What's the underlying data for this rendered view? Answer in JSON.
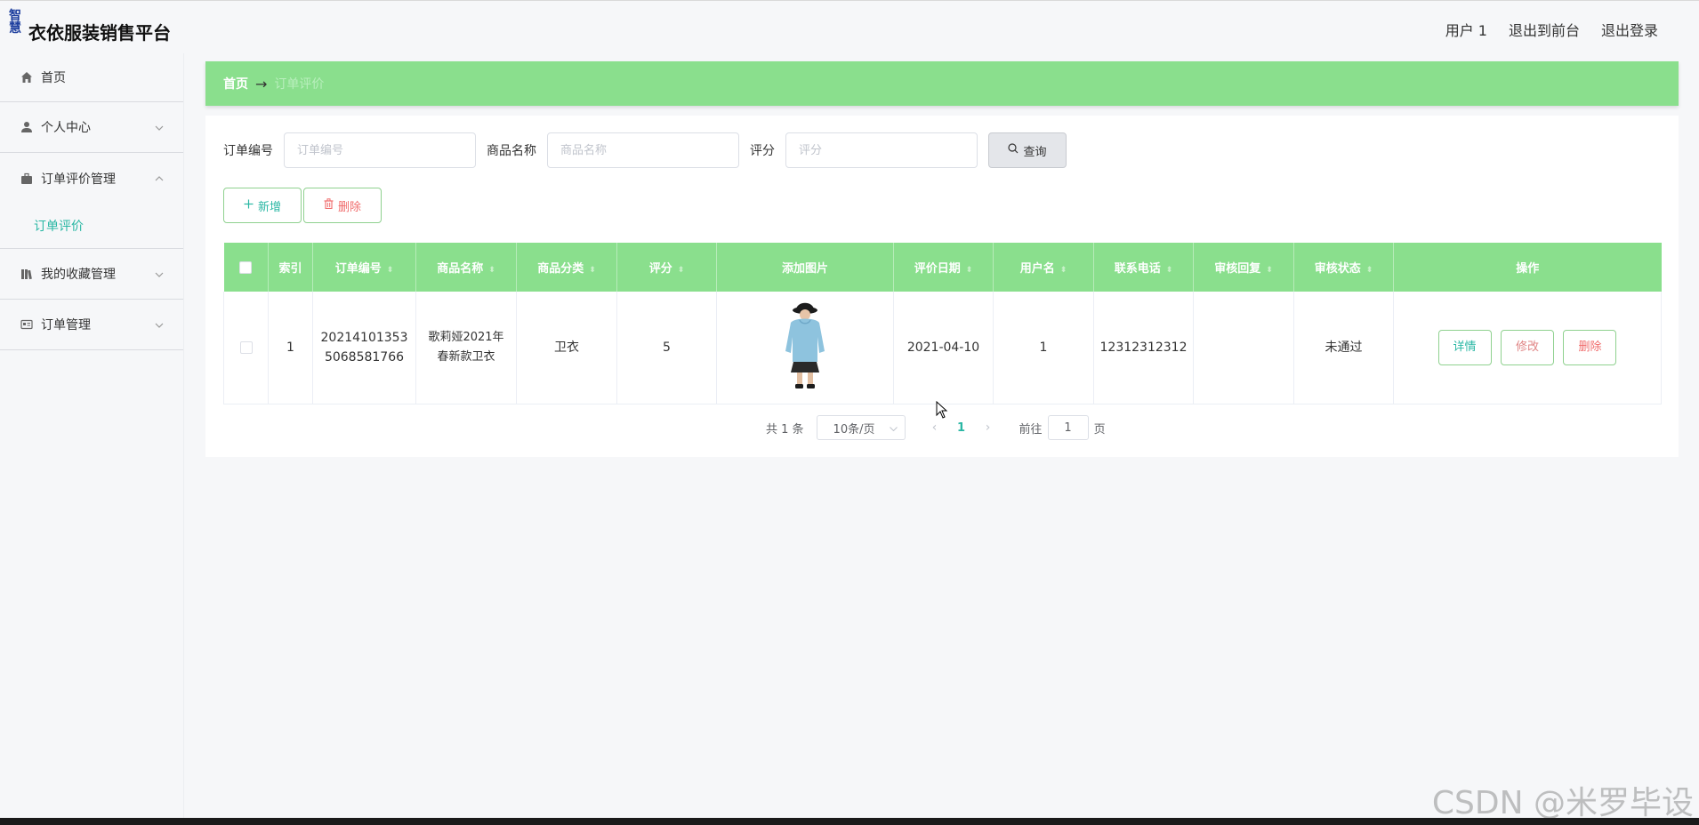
{
  "app": {
    "logo_text": "智慧",
    "title": "衣依服装销售平台"
  },
  "top_links": {
    "user": "用户 1",
    "front": "退出到前台",
    "logout": "退出登录"
  },
  "sidebar": {
    "items": [
      {
        "label": "首页",
        "icon": "home-icon"
      },
      {
        "label": "个人中心",
        "icon": "user-icon"
      },
      {
        "label": "订单评价管理",
        "icon": "briefcase-icon"
      },
      {
        "label": "订单评价",
        "icon": ""
      },
      {
        "label": "我的收藏管理",
        "icon": "library-icon"
      },
      {
        "label": "订单管理",
        "icon": "id-card-icon"
      }
    ]
  },
  "breadcrumb": {
    "home": "首页",
    "arrow": "→",
    "current": "订单评价"
  },
  "search": {
    "order_no_label": "订单编号",
    "order_no_placeholder": "订单编号",
    "product_label": "商品名称",
    "product_placeholder": "商品名称",
    "rating_label": "评分",
    "rating_placeholder": "评分",
    "query_button": "查询"
  },
  "actions": {
    "add": "新增",
    "delete": "删除"
  },
  "table": {
    "headers": [
      "索引",
      "订单编号",
      "商品名称",
      "商品分类",
      "评分",
      "添加图片",
      "评价日期",
      "用户名",
      "联系电话",
      "审核回复",
      "审核状态",
      "操作"
    ],
    "rows": [
      {
        "index": "1",
        "order_no_line1": "20214101353",
        "order_no_line2": "5068581766",
        "product_line1": "歌莉娅2021年",
        "product_line2": "春新款卫衣",
        "category": "卫衣",
        "rating": "5",
        "date": "2021-04-10",
        "username": "1",
        "phone": "12312312312",
        "reply": "",
        "status": "未通过"
      }
    ],
    "op_buttons": {
      "detail": "详情",
      "edit": "修改",
      "delete": "删除"
    }
  },
  "pagination": {
    "total": "共 1 条",
    "page_size": "10条/页",
    "current_page": "1",
    "goto_label": "前往",
    "goto_value": "1",
    "goto_unit": "页"
  },
  "watermark": "CSDN @米罗毕设",
  "colors": {
    "accent_green": "#8adf8d",
    "teal_text": "#2ab7a4",
    "danger_text": "#f06b6b"
  }
}
